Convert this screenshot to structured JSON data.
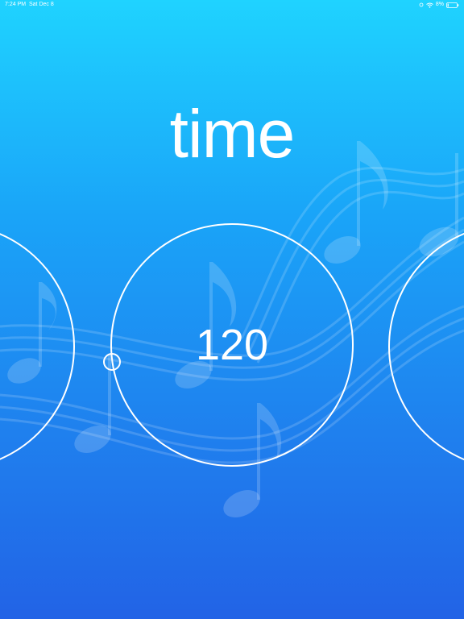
{
  "status_bar": {
    "time": "7:24 PM",
    "date": "Sat Dec 8",
    "battery": "8%"
  },
  "title": "time",
  "dial": {
    "value": "120"
  },
  "colors": {
    "bg_top": "#1fd3ff",
    "bg_bottom": "#2263e6",
    "foreground": "#ffffff"
  },
  "icons": [
    "signal-icon",
    "wifi-icon",
    "battery-icon",
    "music-notes-background"
  ]
}
